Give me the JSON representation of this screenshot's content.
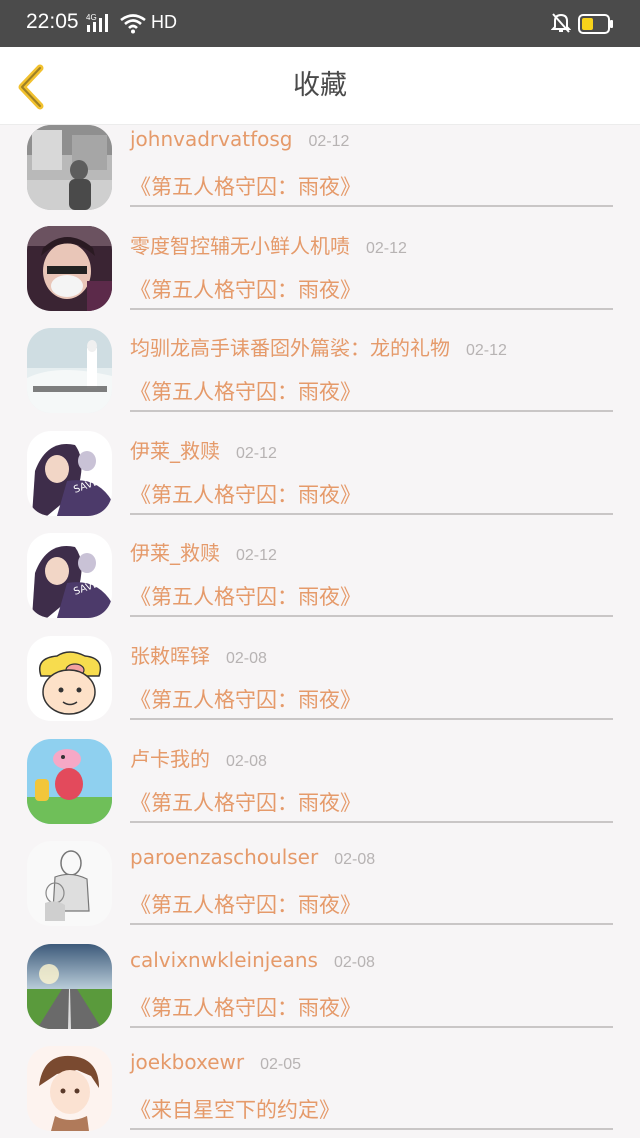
{
  "status_bar": {
    "time": "22:05",
    "network": "4G",
    "hd_label": "HD",
    "icons": [
      "signal-icon",
      "wifi-icon",
      "mute-icon",
      "battery-icon"
    ]
  },
  "header": {
    "title": "收藏",
    "back_icon": "chevron-left-icon",
    "accent_color": "#f2c12e"
  },
  "colors": {
    "name_color": "#e59a6a",
    "date_color": "#b7b3b3",
    "background": "#f7f5f6"
  },
  "items": [
    {
      "name": "johnvadrvatfosg",
      "date": "02-12",
      "book": "《第五人格守囚：雨夜》",
      "avatar": "street-photo-avatar"
    },
    {
      "name": "零度智控辅无小鲜人机啧",
      "date": "02-12",
      "book": "《第五人格守囚：雨夜》",
      "avatar": "masked-person-avatar"
    },
    {
      "name": "均驯龙高手诔番囵外篇裟：龙的礼物",
      "date": "02-12",
      "book": "《第五人格守囚：雨夜》",
      "avatar": "snow-scene-avatar"
    },
    {
      "name": "伊莱_救赎",
      "date": "02-12",
      "book": "《第五人格守囚：雨夜》",
      "avatar": "anime-couple-avatar"
    },
    {
      "name": "伊莱_救赎",
      "date": "02-12",
      "book": "《第五人格守囚：雨夜》",
      "avatar": "anime-couple-avatar"
    },
    {
      "name": "张敕晖铎",
      "date": "02-08",
      "book": "《第五人格守囚：雨夜》",
      "avatar": "cartoon-pig-avatar"
    },
    {
      "name": "卢卡我的",
      "date": "02-08",
      "book": "《第五人格守囚：雨夜》",
      "avatar": "peppa-pig-avatar"
    },
    {
      "name": "paroenzaschoulser",
      "date": "02-08",
      "book": "《第五人格守囚：雨夜》",
      "avatar": "sketch-avatar"
    },
    {
      "name": "calvixnwkleinjeans",
      "date": "02-08",
      "book": "《第五人格守囚：雨夜》",
      "avatar": "road-landscape-avatar"
    },
    {
      "name": "joekboxewr",
      "date": "02-05",
      "book": "《来自星空下的约定》",
      "avatar": "anime-boy-avatar"
    }
  ]
}
